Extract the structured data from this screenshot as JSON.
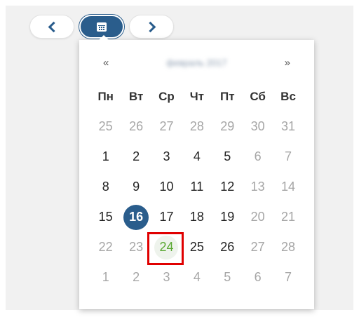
{
  "toolbar": {
    "prev_icon": "chevron-left-icon",
    "calendar_icon": "calendar-icon",
    "next_icon": "chevron-right-icon"
  },
  "calendar": {
    "nav_prev": "«",
    "nav_next": "»",
    "month_title": "февраль 2017",
    "weekdays": [
      "Пн",
      "Вт",
      "Ср",
      "Чт",
      "Пт",
      "Сб",
      "Вс"
    ],
    "weeks": [
      [
        "25",
        "26",
        "27",
        "28",
        "29",
        "30",
        "31"
      ],
      [
        "1",
        "2",
        "3",
        "4",
        "5",
        "6",
        "7"
      ],
      [
        "8",
        "9",
        "10",
        "11",
        "12",
        "13",
        "14"
      ],
      [
        "15",
        "16",
        "17",
        "18",
        "19",
        "20",
        "21"
      ],
      [
        "22",
        "23",
        "24",
        "25",
        "26",
        "27",
        "28"
      ],
      [
        "1",
        "2",
        "3",
        "4",
        "5",
        "6",
        "7"
      ]
    ],
    "selected_day": "16",
    "today_day": "24"
  },
  "colors": {
    "accent": "#2a5d8c",
    "today_text": "#5aa832",
    "highlight": "#e00000"
  }
}
